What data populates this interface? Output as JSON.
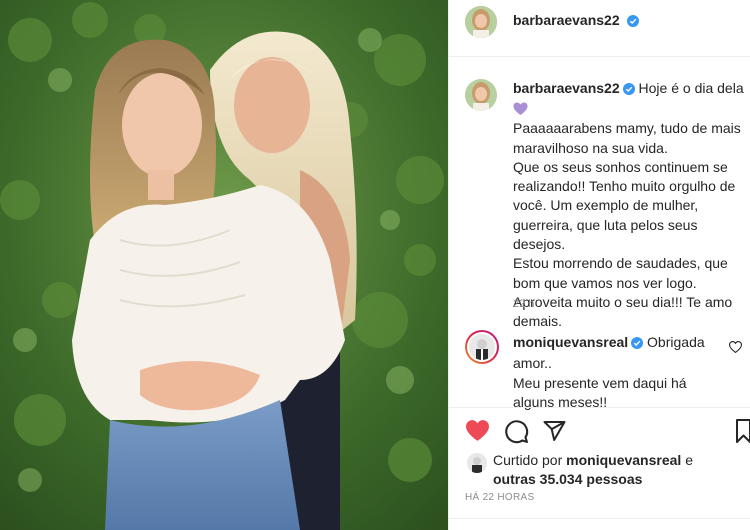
{
  "header": {
    "username": "barbaraevans22"
  },
  "caption": {
    "username": "barbaraevans22",
    "first_line": "Hoje é o dia dela",
    "lines": [
      "Paaaaaarabens mamy, tudo de mais",
      "maravilhoso na sua vida.",
      "Que os seus sonhos continuem se",
      "realizando!! Tenho muito orgulho de",
      "você. Um exemplo de mulher,",
      "guerreira, que luta pelos seus desejos.",
      "Estou morrendo de saudades, que",
      "bom que vamos nos ver logo.",
      "Aproveita muito o seu dia!!! Te amo",
      "demais."
    ],
    "time": "22 h"
  },
  "comment": {
    "username": "moniquevansreal",
    "first_line": "Obrigada",
    "lines": [
      "amor..",
      "Meu presente vem daqui há",
      "alguns meses!!"
    ]
  },
  "likes": {
    "prefix": "Curtido por",
    "user": "moniquevansreal",
    "connector": "e",
    "others": "outras 35.034 pessoas"
  },
  "timestamp": "HÁ 22 HORAS",
  "icons": [
    "heart-icon-filled",
    "comment-icon",
    "share-icon",
    "bookmark-icon",
    "verified-icon",
    "heart-outline-icon",
    "purple-heart-emoji"
  ],
  "colors": {
    "verified": "#3897f0",
    "like_red": "#ed4956",
    "emoji_purple": "#aa8ed6",
    "muted": "#8e8e8e"
  }
}
